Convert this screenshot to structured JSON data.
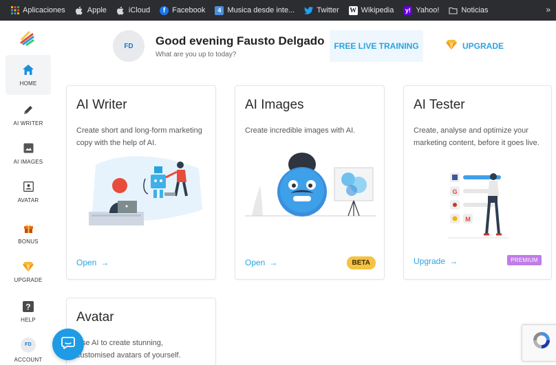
{
  "bookmarks": [
    {
      "label": "Aplicaciones",
      "icon": "apps-grid-icon",
      "color": "#f4b400"
    },
    {
      "label": "Apple",
      "icon": "apple-icon",
      "color": "#d8d8d8"
    },
    {
      "label": "iCloud",
      "icon": "apple-icon",
      "color": "#d8d8d8"
    },
    {
      "label": "Facebook",
      "icon": "facebook-icon",
      "color": "#1877f2"
    },
    {
      "label": "Musica desde inte...",
      "icon": "music-icon",
      "color": "#4a90d9"
    },
    {
      "label": "Twitter",
      "icon": "twitter-icon",
      "color": "#1da1f2"
    },
    {
      "label": "Wikipedia",
      "icon": "wikipedia-icon",
      "color": "#ffffff"
    },
    {
      "label": "Yahoo!",
      "icon": "yahoo-icon",
      "color": "#6001d2"
    },
    {
      "label": "Noticias",
      "icon": "folder-icon",
      "color": "#d8d8d8"
    }
  ],
  "bookmarks_more": "»",
  "sidebar": {
    "items": [
      {
        "label": "HOME",
        "icon": "home-icon"
      },
      {
        "label": "AI WRITER",
        "icon": "pencil-icon"
      },
      {
        "label": "AI IMAGES",
        "icon": "image-icon"
      },
      {
        "label": "AVATAR",
        "icon": "portrait-icon"
      },
      {
        "label": "BONUS",
        "icon": "gift-icon"
      },
      {
        "label": "UPGRADE",
        "icon": "diamond-icon"
      },
      {
        "label": "HELP",
        "icon": "question-icon"
      },
      {
        "label": "ACCOUNT",
        "icon": "account-avatar",
        "initials": "FD"
      }
    ]
  },
  "header": {
    "initials": "FD",
    "greeting": "Good evening Fausto Delgado",
    "subtitle": "What are you up to today?",
    "training_label": "FREE LIVE TRAINING",
    "upgrade_label": "UPGRADE"
  },
  "cards": [
    {
      "title": "AI Writer",
      "description": "Create short and long-form marketing copy with the help of AI.",
      "link": "Open",
      "arrow": "→"
    },
    {
      "title": "AI Images",
      "description": "Create incredible images with AI.",
      "link": "Open",
      "arrow": "→",
      "badge": "BETA"
    },
    {
      "title": "AI Tester",
      "description": "Create, analyse and optimize your marketing content, before it goes live.",
      "link": "Upgrade",
      "arrow": "→",
      "badge": "PREMIUM"
    },
    {
      "title": "Avatar",
      "description": "Use AI to create stunning, customised avatars of yourself."
    }
  ],
  "colors": {
    "accent": "#29a3e0",
    "beta": "#f6c243",
    "premium": "#c07ce8",
    "chat": "#1e9be6"
  }
}
